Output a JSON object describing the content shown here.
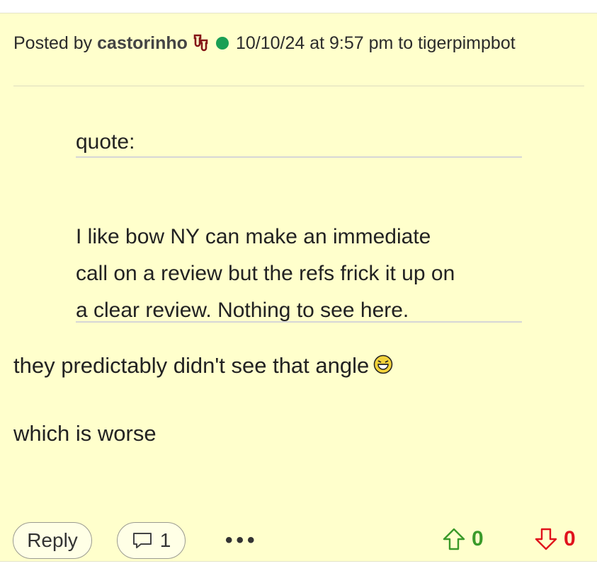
{
  "post": {
    "posted_by_prefix": "Posted by",
    "author": "castorinho",
    "team_icon": "ou-logo-icon",
    "online_status": "online",
    "timestamp": "10/10/24 at 9:57 pm",
    "to_prefix": "to",
    "reply_to": "tigerpimpbot",
    "quote_label": "quote:",
    "quote_lines": [
      "I like bow NY can make an immediate",
      "call on a review but the refs frick it up on",
      "a clear review. Nothing to see here."
    ],
    "body_lines": [
      "they predictably didn't see that angle",
      "which is worse"
    ],
    "emoji": "laughing-emoji"
  },
  "actions": {
    "reply_label": "Reply",
    "comment_count": "1",
    "more_label": "•••",
    "upvotes": "0",
    "downvotes": "0"
  },
  "colors": {
    "background": "#ffffcc",
    "online": "#1a9f55",
    "upvote": "#3a9a2a",
    "downvote": "#e0121c",
    "team": "#841617"
  }
}
